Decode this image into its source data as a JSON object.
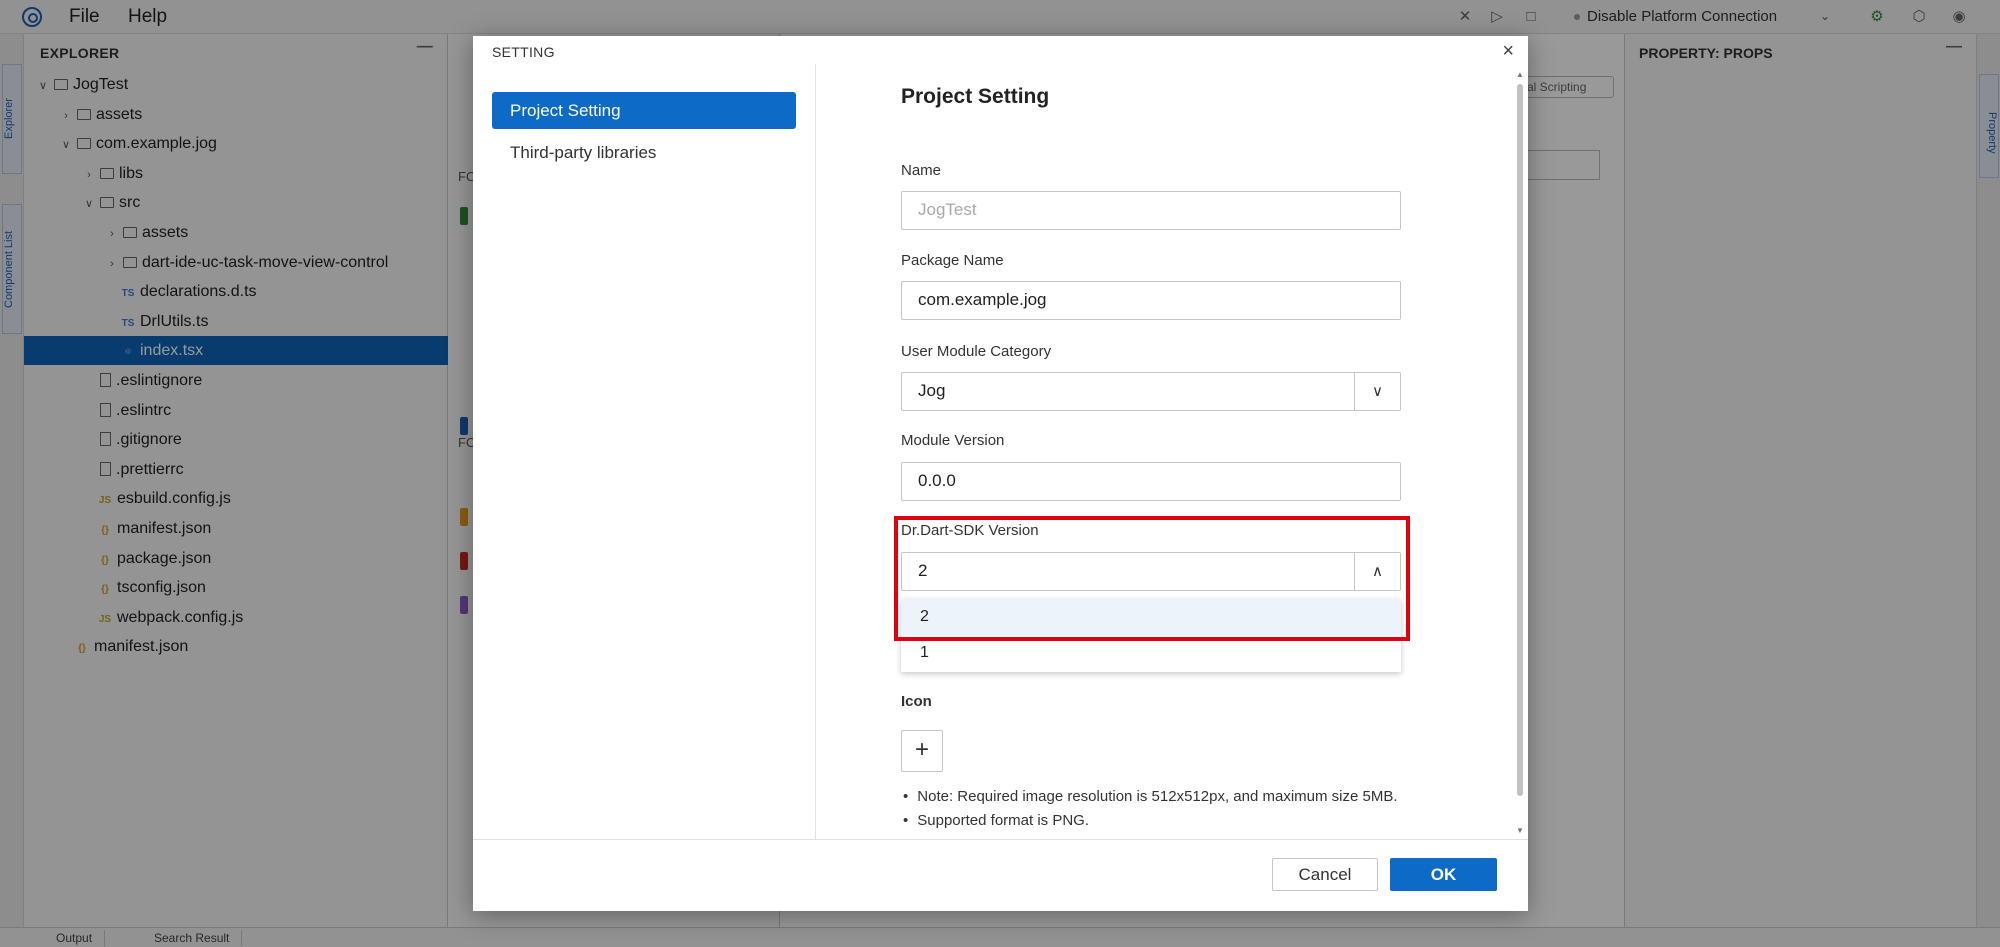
{
  "menubar": {
    "menus": [
      "File",
      "Help"
    ],
    "platform_label": "Disable Platform Connection"
  },
  "side_tabs": [
    "Explorer",
    "Component List"
  ],
  "explorer": {
    "title": "EXPLORER",
    "tree": [
      {
        "label": "JogTest",
        "kind": "folder",
        "open": true
      },
      {
        "label": "assets",
        "kind": "folder",
        "open": false
      },
      {
        "label": "com.example.jog",
        "kind": "folder",
        "open": true
      },
      {
        "label": "libs",
        "kind": "folder",
        "open": false
      },
      {
        "label": "src",
        "kind": "folder",
        "open": true
      },
      {
        "label": "assets",
        "kind": "folder",
        "open": false
      },
      {
        "label": "dart-ide-uc-task-move-view-control",
        "kind": "folder",
        "open": false
      },
      {
        "label": "declarations.d.ts",
        "kind": "ts"
      },
      {
        "label": "DrlUtils.ts",
        "kind": "ts"
      },
      {
        "label": "index.tsx",
        "kind": "tsx",
        "selected": true
      },
      {
        "label": ".eslintignore",
        "kind": "file"
      },
      {
        "label": ".eslintrc",
        "kind": "file"
      },
      {
        "label": ".gitignore",
        "kind": "file"
      },
      {
        "label": ".prettierrc",
        "kind": "file"
      },
      {
        "label": "esbuild.config.js",
        "kind": "js"
      },
      {
        "label": "manifest.json",
        "kind": "json"
      },
      {
        "label": "package.json",
        "kind": "json"
      },
      {
        "label": "tsconfig.json",
        "kind": "json"
      },
      {
        "label": "webpack.config.js",
        "kind": "js"
      },
      {
        "label": "manifest.json",
        "kind": "json"
      }
    ]
  },
  "editor": {
    "pill_label": "al Scripting"
  },
  "property": {
    "title": "PROPERTY: PROPS",
    "side_tab": "Property"
  },
  "statusbar": {
    "tabs": [
      "Output",
      "Search Result"
    ]
  },
  "dialog": {
    "title": "SETTING",
    "nav": [
      "Project Setting",
      "Third-party libraries"
    ],
    "heading": "Project Setting",
    "name_label": "Name",
    "name_value": "JogTest",
    "package_label": "Package Name",
    "package_value": "com.example.jog",
    "category_label": "User Module Category",
    "category_value": "Jog",
    "version_label": "Module Version",
    "version_value": "0.0.0",
    "sdk_label": "Dr.Dart-SDK Version",
    "sdk_value": "2",
    "sdk_options": [
      "2",
      "1"
    ],
    "icon_label": "Icon",
    "notes": [
      "Note: Required image resolution is 512x512px, and maximum size 5MB.",
      "Supported format is PNG."
    ],
    "cancel_label": "Cancel",
    "ok_label": "OK"
  },
  "colors": {
    "accent": "#0e6ac7",
    "selection": "#0e63b8",
    "highlight_border": "#e0000f"
  }
}
